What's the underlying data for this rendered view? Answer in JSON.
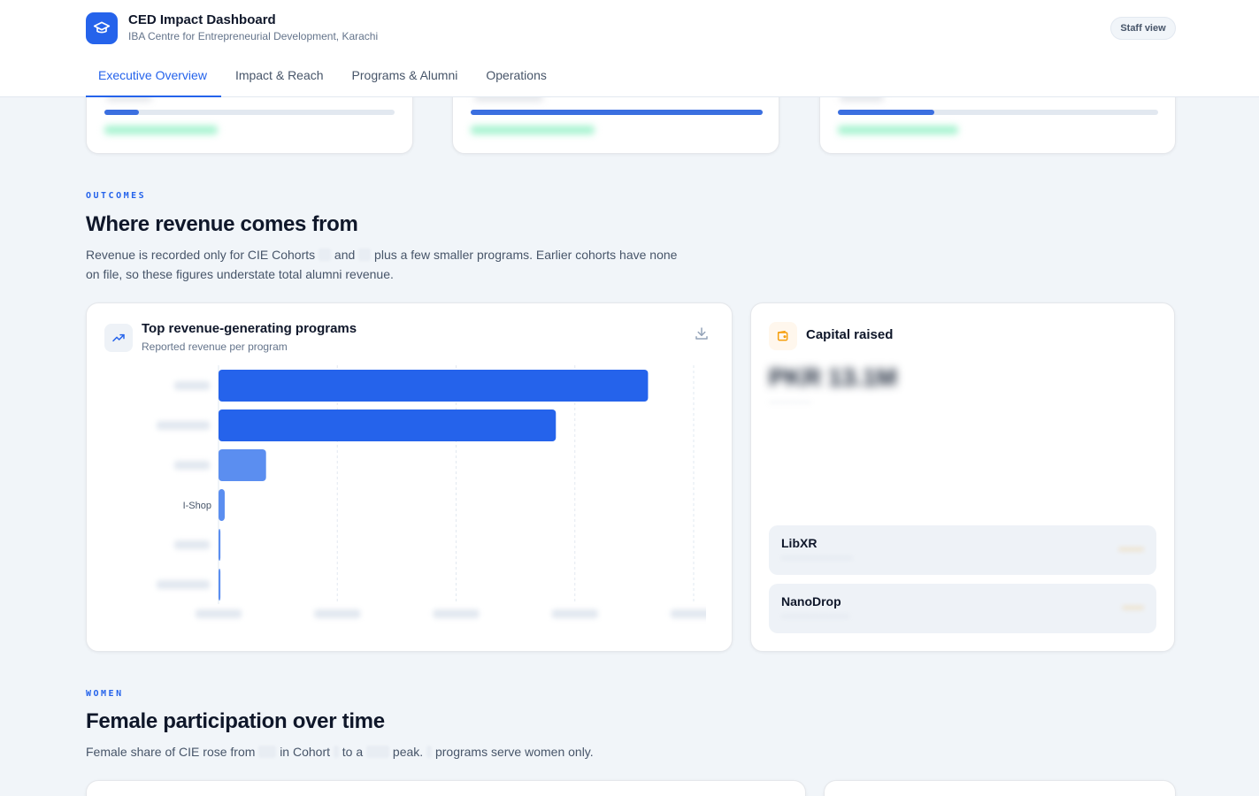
{
  "header": {
    "app_title": "CED Impact Dashboard",
    "app_subtitle": "IBA Centre for Entrepreneurial Development, Karachi",
    "staff_view_label": "Staff view",
    "logo_icon": "graduation-cap-icon"
  },
  "tabs": [
    {
      "label": "Executive Overview",
      "active": true
    },
    {
      "label": "Impact & Reach",
      "active": false
    },
    {
      "label": "Programs & Alumni",
      "active": false
    },
    {
      "label": "Operations",
      "active": false
    }
  ],
  "kpi_cards": [
    {
      "progress": 0.12
    },
    {
      "progress": 1.0
    },
    {
      "progress": 0.3
    }
  ],
  "outcomes": {
    "eyebrow": "OUTCOMES",
    "heading": "Where revenue comes from",
    "lead_part1": "Revenue is recorded only for CIE Cohorts",
    "lead_and": "and",
    "lead_part2": "plus a few smaller programs. Earlier cohorts have none",
    "lead_line2": "on file, so these figures understate total alumni revenue."
  },
  "revenue_card": {
    "title": "Top revenue-generating programs",
    "subtitle": "Reported revenue per program",
    "icon": "trending-up-icon",
    "download_icon": "download-icon"
  },
  "chart_data": {
    "type": "bar",
    "orientation": "horizontal",
    "title": "Top revenue-generating programs",
    "subtitle": "Reported revenue per program",
    "categories": [
      "",
      "",
      "",
      "I-Shop",
      "",
      ""
    ],
    "values": [
      0.904,
      0.71,
      0.1,
      0.013,
      0.004,
      0.004
    ],
    "bar_colors": [
      "#2563eb",
      "#2563eb",
      "#5b8ef0",
      "#5b8ef0",
      "#5b8ef0",
      "#5b8ef0"
    ],
    "xlim": [
      0,
      1
    ],
    "grid": true,
    "labels_obscured": true
  },
  "capital_card": {
    "title": "Capital raised",
    "icon": "wallet-icon",
    "rows": [
      {
        "name": "LibXR"
      },
      {
        "name": "NanoDrop"
      }
    ]
  },
  "women": {
    "eyebrow": "WOMEN",
    "heading": "Female participation over time",
    "lead_a": "Female share of CIE rose from",
    "lead_b": "in Cohort",
    "lead_c": "to a",
    "lead_d": "peak.",
    "lead_e": "programs serve women only."
  },
  "colors": {
    "accent": "#2563eb",
    "bar_light": "#5b8ef0",
    "amber": "#f59e0b",
    "background": "#f1f5f9"
  }
}
